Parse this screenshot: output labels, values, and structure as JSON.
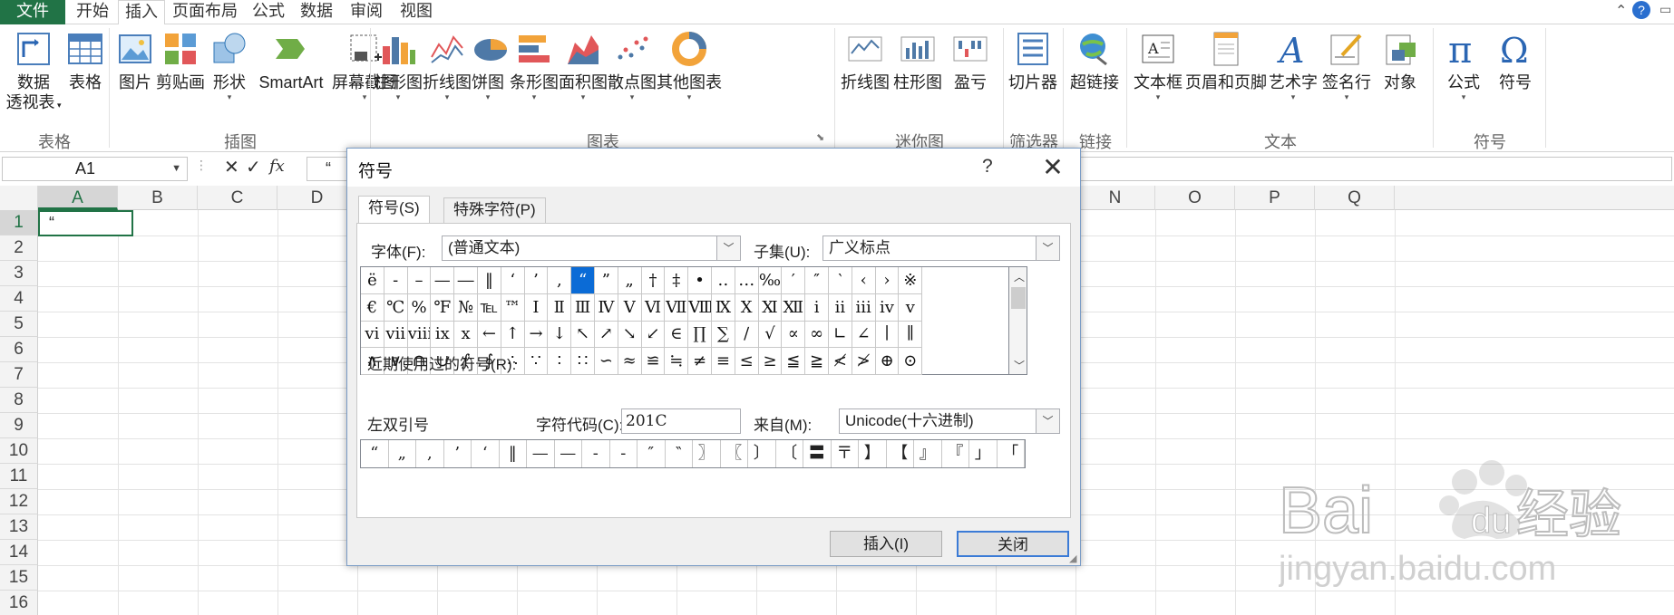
{
  "tabs": [
    "文件",
    "开始",
    "插入",
    "页面布局",
    "公式",
    "数据",
    "审阅",
    "视图"
  ],
  "ribbon": {
    "buttons": {
      "pivot_line1": "数据",
      "pivot_line2": "透视表",
      "table": "表格",
      "picture": "图片",
      "clipart": "剪贴画",
      "shapes": "形状",
      "smartart": "SmartArt",
      "screenshot": "屏幕截图",
      "column_chart": "柱形图",
      "line_chart": "折线图",
      "pie_chart": "饼图",
      "bar_chart": "条形图",
      "area_chart": "面积图",
      "scatter_chart": "散点图",
      "other_charts": "其他图表",
      "spark_line": "折线图",
      "spark_column": "柱形图",
      "spark_winloss": "盈亏",
      "slicer": "切片器",
      "hyperlink": "超链接",
      "textbox": "文本框",
      "header_footer": "页眉和页脚",
      "wordart": "艺术字",
      "signature": "签名行",
      "object": "对象",
      "equation": "公式",
      "symbol": "符号"
    },
    "groups": {
      "tables": "表格",
      "illustrations": "插图",
      "charts": "图表",
      "sparklines": "迷你图",
      "filter": "筛选器",
      "links": "链接",
      "text": "文本",
      "symbols": "符号"
    }
  },
  "formula_bar": {
    "name_box": "A1",
    "fx": "fx",
    "content": "“"
  },
  "sheet": {
    "columns": [
      "A",
      "B",
      "C",
      "D",
      "E",
      "F",
      "G",
      "H",
      "I",
      "J",
      "K",
      "L",
      "M",
      "N",
      "O",
      "P",
      "Q"
    ],
    "rows": [
      "1",
      "2",
      "3",
      "4",
      "5",
      "6",
      "7",
      "8",
      "9",
      "10",
      "11",
      "12",
      "13",
      "14",
      "15",
      "16"
    ],
    "a1_value": "“"
  },
  "dialog": {
    "title": "符号",
    "help": "?",
    "close_glyph": "✕",
    "tab_symbols": "符号(S)",
    "tab_special": "特殊字符(P)",
    "font_label": "字体(F):",
    "font_value": "(普通文本)",
    "subset_label": "子集(U):",
    "subset_value": "广义标点",
    "symbols": [
      [
        "ë",
        "-",
        "–",
        "—",
        "―",
        "‖",
        "‘",
        "’",
        "‚",
        "“",
        "”",
        "„",
        "†",
        "‡",
        "•",
        "‥",
        "…",
        "‰",
        "′",
        "″",
        "‵",
        "‹",
        "›",
        "※"
      ],
      [
        "€",
        "℃",
        "%",
        "℉",
        "№",
        "℡",
        "™",
        "Ⅰ",
        "Ⅱ",
        "Ⅲ",
        "Ⅳ",
        "Ⅴ",
        "Ⅵ",
        "Ⅶ",
        "Ⅷ",
        "Ⅸ",
        "Ⅹ",
        "Ⅺ",
        "Ⅻ",
        "ⅰ",
        "ⅱ",
        "ⅲ",
        "ⅳ",
        "ⅴ"
      ],
      [
        "ⅵ",
        "ⅶ",
        "ⅷ",
        "ⅸ",
        "ⅹ",
        "←",
        "↑",
        "→",
        "↓",
        "↖",
        "↗",
        "↘",
        "↙",
        "∈",
        "∏",
        "∑",
        "∕",
        "√",
        "∝",
        "∞",
        "∟",
        "∠",
        "∣",
        "∥"
      ],
      [
        "∧",
        "∨",
        "∩",
        "∪",
        "∫",
        "∮",
        "∴",
        "∵",
        "∶",
        "∷",
        "∽",
        "≈",
        "≌",
        "≒",
        "≠",
        "≡",
        "≤",
        "≥",
        "≦",
        "≧",
        "≮",
        "≯",
        "⊕",
        "⊙"
      ]
    ],
    "selected_symbol": "“",
    "recent_label": "近期使用过的符号(R):",
    "recent": [
      "“",
      "„",
      "‚",
      "’",
      "‘",
      "‖",
      "—",
      "—",
      "-",
      "-",
      "″",
      "‶",
      "〗",
      "〖",
      "〕",
      "〔",
      "〓",
      "〒",
      "】",
      "【",
      "』",
      "『",
      "」",
      "「"
    ],
    "char_name": "左双引号",
    "code_label": "字符代码(C):",
    "code_value": "201C",
    "from_label": "来自(M):",
    "from_value": "Unicode(十六进制)",
    "insert_button": "插入(I)",
    "close_button": "关闭"
  },
  "watermark": {
    "brand": "Bai",
    "brand2": "du",
    "cn": "经验",
    "url": "jingyan.baidu.com"
  },
  "colors": {
    "excel_green": "#217346",
    "selection_blue": "#0b6bd6"
  }
}
